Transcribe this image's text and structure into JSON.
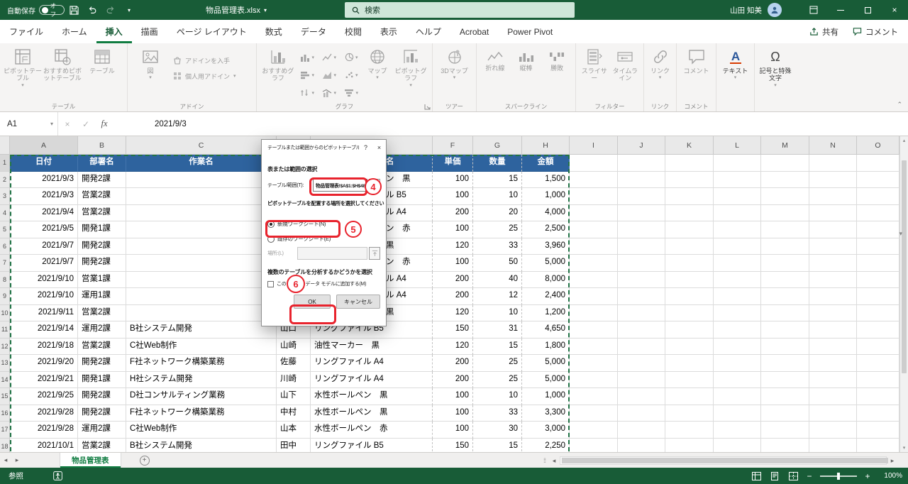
{
  "titlebar": {
    "autosave_label": "自動保存",
    "autosave_state": "オフ",
    "doc_title": "物品管理表.xlsx",
    "search_placeholder": "検索",
    "user_name": "山田 知美"
  },
  "ribbon_tabs": {
    "file": "ファイル",
    "home": "ホーム",
    "insert": "挿入",
    "draw": "描画",
    "page_layout": "ページ レイアウト",
    "formulas": "数式",
    "data": "データ",
    "review": "校閲",
    "view": "表示",
    "help": "ヘルプ",
    "acrobat": "Acrobat",
    "power_pivot": "Power Pivot",
    "share": "共有",
    "comments": "コメント"
  },
  "ribbon": {
    "pivot_table": "ピボットテーブル",
    "recommended_pivots": "おすすめピボットテーブル",
    "table": "テーブル",
    "tables_group": "テーブル",
    "pictures": "図",
    "get_addins": "アドインを入手",
    "my_addins": "個人用アドイン",
    "addins_group": "アドイン",
    "recommended_charts": "おすすめグラフ",
    "maps": "マップ",
    "pivot_chart": "ピボットグラフ",
    "charts_group": "グラフ",
    "map_3d": "3Dマップ",
    "tours_group": "ツアー",
    "spark_line": "折れ線",
    "spark_column": "縦棒",
    "spark_winloss": "勝敗",
    "sparklines_group": "スパークライン",
    "slicer": "スライサー",
    "timeline": "タイムライン",
    "filters_group": "フィルター",
    "link": "リンク",
    "links_group": "リンク",
    "comment": "コメント",
    "comments_group": "コメント",
    "text": "テキスト",
    "symbols": "記号と特殊文字"
  },
  "formula_bar": {
    "name_box": "A1",
    "fx": "fx",
    "value": "2021/9/3"
  },
  "sheet": {
    "col_letters": [
      "A",
      "B",
      "C",
      "D",
      "E",
      "F",
      "G",
      "H",
      "I",
      "J",
      "K",
      "L",
      "M",
      "N",
      "O"
    ],
    "header_row": {
      "date": "日付",
      "dept": "部署名",
      "task": "作業名",
      "person": "",
      "item": "名",
      "price": "単価",
      "qty": "数量",
      "amount": "金額"
    },
    "rows": [
      {
        "date": "2021/9/3",
        "dept": "開発2課",
        "task": "",
        "person": "",
        "item": "ン　黒",
        "frag": true,
        "price": "100",
        "qty": "15",
        "amount": "1,500"
      },
      {
        "date": "2021/9/3",
        "dept": "営業2課",
        "task": "",
        "person": "",
        "item": "ル B5",
        "frag": true,
        "price": "100",
        "qty": "10",
        "amount": "1,000"
      },
      {
        "date": "2021/9/4",
        "dept": "営業2課",
        "task": "",
        "person": "",
        "item": "ル A4",
        "frag": true,
        "price": "200",
        "qty": "20",
        "amount": "4,000"
      },
      {
        "date": "2021/9/5",
        "dept": "開発1課",
        "task": "",
        "person": "",
        "item": "ン　赤",
        "frag": true,
        "price": "100",
        "qty": "25",
        "amount": "2,500"
      },
      {
        "date": "2021/9/7",
        "dept": "開発2課",
        "task": "",
        "person": "",
        "item": "黒",
        "frag": true,
        "price": "120",
        "qty": "33",
        "amount": "3,960"
      },
      {
        "date": "2021/9/7",
        "dept": "開発2課",
        "task": "",
        "person": "",
        "item": "ン　赤",
        "frag": true,
        "price": "100",
        "qty": "50",
        "amount": "5,000"
      },
      {
        "date": "2021/9/10",
        "dept": "営業1課",
        "task": "",
        "person": "",
        "item": "ル A4",
        "frag": true,
        "price": "200",
        "qty": "40",
        "amount": "8,000"
      },
      {
        "date": "2021/9/10",
        "dept": "運用1課",
        "task": "",
        "person": "",
        "item": "ル A4",
        "frag": true,
        "price": "200",
        "qty": "12",
        "amount": "2,400"
      },
      {
        "date": "2021/9/11",
        "dept": "営業2課",
        "task": "",
        "person": "",
        "item": "黒",
        "frag": true,
        "price": "120",
        "qty": "10",
        "amount": "1,200"
      },
      {
        "date": "2021/9/14",
        "dept": "運用2課",
        "task": "B社システム開発",
        "person": "山口",
        "item": "リングファイル B5",
        "frag": false,
        "price": "150",
        "qty": "31",
        "amount": "4,650"
      },
      {
        "date": "2021/9/18",
        "dept": "営業2課",
        "task": "C社Web制作",
        "person": "山崎",
        "item": "油性マーカー　黒",
        "frag": false,
        "price": "120",
        "qty": "15",
        "amount": "1,800"
      },
      {
        "date": "2021/9/20",
        "dept": "開発2課",
        "task": "F社ネットワーク構築業務",
        "person": "佐藤",
        "item": "リングファイル A4",
        "frag": false,
        "price": "200",
        "qty": "25",
        "amount": "5,000"
      },
      {
        "date": "2021/9/21",
        "dept": "開発1課",
        "task": "H社システム開発",
        "person": "川崎",
        "item": "リングファイル A4",
        "frag": false,
        "price": "200",
        "qty": "25",
        "amount": "5,000"
      },
      {
        "date": "2021/9/25",
        "dept": "開発2課",
        "task": "D社コンサルティング業務",
        "person": "山下",
        "item": "水性ボールペン　黒",
        "frag": false,
        "price": "100",
        "qty": "10",
        "amount": "1,000"
      },
      {
        "date": "2021/9/28",
        "dept": "開発2課",
        "task": "F社ネットワーク構築業務",
        "person": "中村",
        "item": "水性ボールペン　黒",
        "frag": false,
        "price": "100",
        "qty": "33",
        "amount": "3,300"
      },
      {
        "date": "2021/9/28",
        "dept": "運用2課",
        "task": "C社Web制作",
        "person": "山本",
        "item": "水性ボールペン　赤",
        "frag": false,
        "price": "100",
        "qty": "30",
        "amount": "3,000"
      },
      {
        "date": "2021/10/1",
        "dept": "営業2課",
        "task": "B社システム開発",
        "person": "田中",
        "item": "リングファイル B5",
        "frag": false,
        "price": "150",
        "qty": "15",
        "amount": "2,250"
      }
    ],
    "active_sheet": "物品管理表"
  },
  "dialog": {
    "title": "テーブルまたは範囲からのピボットテーブル",
    "help": "?",
    "close": "×",
    "section_range": "表または範囲の選択",
    "range_label": "テーブル/範囲(T):",
    "range_value": "物品管理表!$A$1:$H$48",
    "section_placement": "ピボットテーブルを配置する場所を選択してください",
    "radio_new": "新規ワークシート(N)",
    "radio_existing": "既存のワークシート(E)",
    "location_label": "場所:(L)",
    "location_value": "",
    "section_multi": "複数のテーブルを分析するかどうかを選択",
    "checkbox_datamodel": "このデータをデータ モデルに追加する(M)",
    "ok": "OK",
    "cancel": "キャンセル"
  },
  "annotations": {
    "range_step": "4",
    "worksheet_step": "5",
    "ok_step": "6"
  },
  "status_bar": {
    "mode": "参照",
    "zoom_level": "100%"
  }
}
